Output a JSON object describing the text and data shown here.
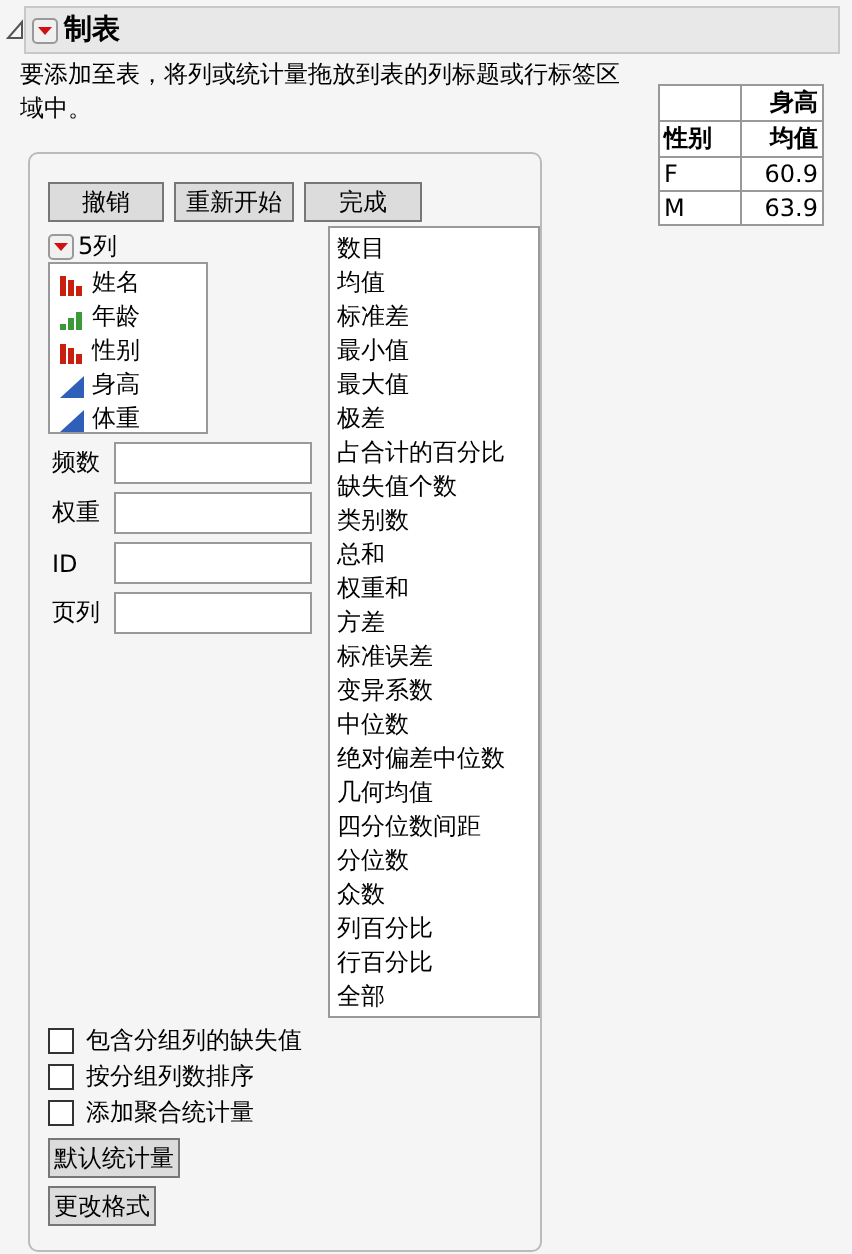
{
  "header": {
    "title": "制表",
    "expanded": true
  },
  "instructions": "要添加至表，将列或统计量拖放到表的列标题或行标签区域中。",
  "result_table": {
    "column_header": "身高",
    "row_label_header": "性别",
    "stat_header": "均值",
    "rows": [
      {
        "label": "F",
        "value": "60.9"
      },
      {
        "label": "M",
        "value": "63.9"
      }
    ]
  },
  "action_buttons": [
    "撤销",
    "重新开始",
    "完成"
  ],
  "columns_header": "5列",
  "columns": [
    {
      "name": "姓名",
      "kind": "nominal"
    },
    {
      "name": "年龄",
      "kind": "ordinal"
    },
    {
      "name": "性别",
      "kind": "nominal"
    },
    {
      "name": "身高",
      "kind": "continuous"
    },
    {
      "name": "体重",
      "kind": "continuous"
    }
  ],
  "role_fields": [
    "频数",
    "权重",
    "ID",
    "页列"
  ],
  "statistics": [
    "数目",
    "均值",
    "标准差",
    "最小值",
    "最大值",
    "极差",
    "占合计的百分比",
    "缺失值个数",
    "类别数",
    "总和",
    "权重和",
    "方差",
    "标准误差",
    "变异系数",
    "中位数",
    "绝对偏差中位数",
    "几何均值",
    "四分位数间距",
    "分位数",
    "众数",
    "列百分比",
    "行百分比",
    "全部"
  ],
  "options": [
    {
      "label": "包含分组列的缺失值",
      "checked": false
    },
    {
      "label": "按分组列数排序",
      "checked": false
    },
    {
      "label": "添加聚合统计量",
      "checked": false
    }
  ],
  "bottom_buttons": [
    "默认统计量",
    "更改格式"
  ]
}
